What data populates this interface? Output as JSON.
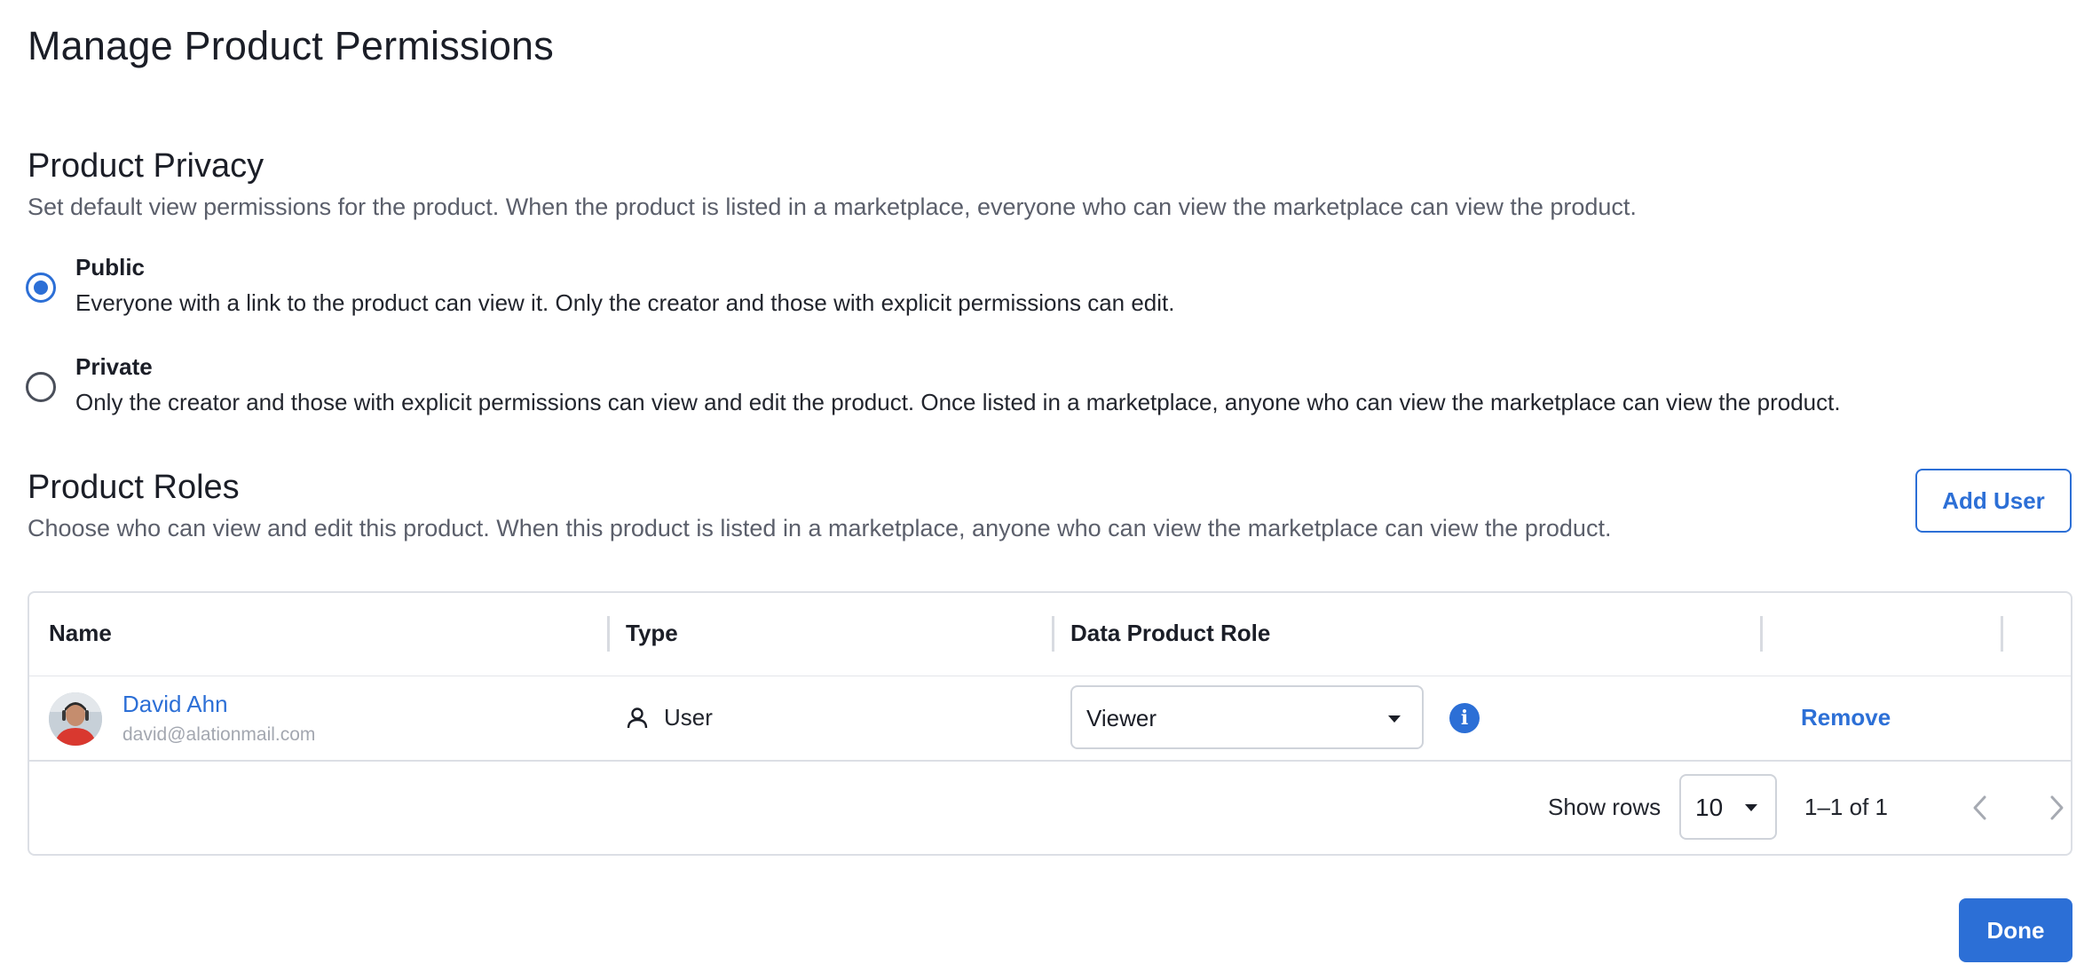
{
  "page": {
    "title": "Manage Product Permissions"
  },
  "privacy": {
    "title": "Product Privacy",
    "description": "Set default view permissions for the product. When the product is listed in a marketplace, everyone who can view the marketplace can view the product.",
    "options": [
      {
        "label": "Public",
        "description": "Everyone with a link to the product can view it. Only the creator and those with explicit permissions can edit.",
        "selected": true
      },
      {
        "label": "Private",
        "description": "Only the creator and those with explicit permissions can view and edit the product. Once listed in a marketplace, anyone who can view the marketplace can view the product.",
        "selected": false
      }
    ]
  },
  "roles": {
    "title": "Product Roles",
    "description": "Choose who can view and edit this product. When this product is listed in a marketplace, anyone who can view the marketplace can view the product.",
    "add_user_label": "Add User",
    "table": {
      "columns": [
        "Name",
        "Type",
        "Data Product Role",
        "",
        ""
      ],
      "rows": [
        {
          "name": "David Ahn",
          "email": "david@alationmail.com",
          "type": "User",
          "type_icon": "person-icon",
          "role": "Viewer",
          "action": "Remove"
        }
      ],
      "pagination": {
        "show_rows_label": "Show rows",
        "rows_per_page": "10",
        "range": "1–1 of 1"
      }
    }
  },
  "footer": {
    "done_label": "Done"
  },
  "colors": {
    "accent": "#2c6fd6",
    "text": "#1b1e27",
    "muted": "#5b5f6b",
    "border": "#dcdfe5"
  }
}
